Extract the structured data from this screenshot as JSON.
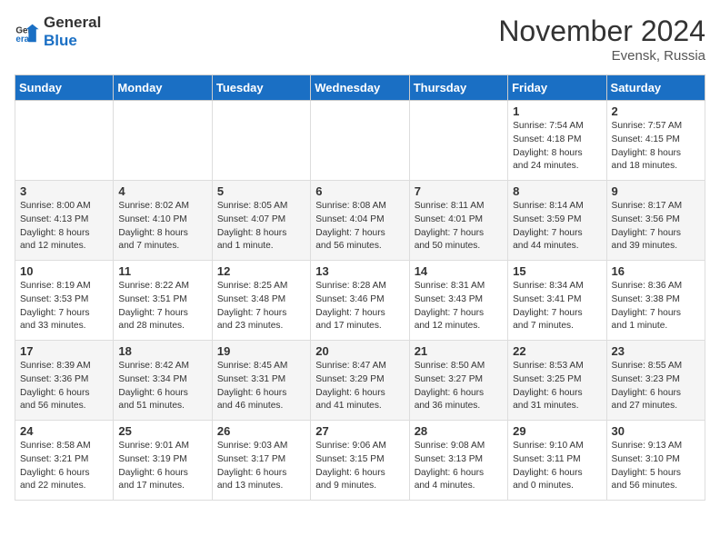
{
  "header": {
    "logo_general": "General",
    "logo_blue": "Blue",
    "month_title": "November 2024",
    "location": "Evensk, Russia"
  },
  "days_of_week": [
    "Sunday",
    "Monday",
    "Tuesday",
    "Wednesday",
    "Thursday",
    "Friday",
    "Saturday"
  ],
  "weeks": [
    [
      {
        "day": "",
        "info": ""
      },
      {
        "day": "",
        "info": ""
      },
      {
        "day": "",
        "info": ""
      },
      {
        "day": "",
        "info": ""
      },
      {
        "day": "",
        "info": ""
      },
      {
        "day": "1",
        "info": "Sunrise: 7:54 AM\nSunset: 4:18 PM\nDaylight: 8 hours\nand 24 minutes."
      },
      {
        "day": "2",
        "info": "Sunrise: 7:57 AM\nSunset: 4:15 PM\nDaylight: 8 hours\nand 18 minutes."
      }
    ],
    [
      {
        "day": "3",
        "info": "Sunrise: 8:00 AM\nSunset: 4:13 PM\nDaylight: 8 hours\nand 12 minutes."
      },
      {
        "day": "4",
        "info": "Sunrise: 8:02 AM\nSunset: 4:10 PM\nDaylight: 8 hours\nand 7 minutes."
      },
      {
        "day": "5",
        "info": "Sunrise: 8:05 AM\nSunset: 4:07 PM\nDaylight: 8 hours\nand 1 minute."
      },
      {
        "day": "6",
        "info": "Sunrise: 8:08 AM\nSunset: 4:04 PM\nDaylight: 7 hours\nand 56 minutes."
      },
      {
        "day": "7",
        "info": "Sunrise: 8:11 AM\nSunset: 4:01 PM\nDaylight: 7 hours\nand 50 minutes."
      },
      {
        "day": "8",
        "info": "Sunrise: 8:14 AM\nSunset: 3:59 PM\nDaylight: 7 hours\nand 44 minutes."
      },
      {
        "day": "9",
        "info": "Sunrise: 8:17 AM\nSunset: 3:56 PM\nDaylight: 7 hours\nand 39 minutes."
      }
    ],
    [
      {
        "day": "10",
        "info": "Sunrise: 8:19 AM\nSunset: 3:53 PM\nDaylight: 7 hours\nand 33 minutes."
      },
      {
        "day": "11",
        "info": "Sunrise: 8:22 AM\nSunset: 3:51 PM\nDaylight: 7 hours\nand 28 minutes."
      },
      {
        "day": "12",
        "info": "Sunrise: 8:25 AM\nSunset: 3:48 PM\nDaylight: 7 hours\nand 23 minutes."
      },
      {
        "day": "13",
        "info": "Sunrise: 8:28 AM\nSunset: 3:46 PM\nDaylight: 7 hours\nand 17 minutes."
      },
      {
        "day": "14",
        "info": "Sunrise: 8:31 AM\nSunset: 3:43 PM\nDaylight: 7 hours\nand 12 minutes."
      },
      {
        "day": "15",
        "info": "Sunrise: 8:34 AM\nSunset: 3:41 PM\nDaylight: 7 hours\nand 7 minutes."
      },
      {
        "day": "16",
        "info": "Sunrise: 8:36 AM\nSunset: 3:38 PM\nDaylight: 7 hours\nand 1 minute."
      }
    ],
    [
      {
        "day": "17",
        "info": "Sunrise: 8:39 AM\nSunset: 3:36 PM\nDaylight: 6 hours\nand 56 minutes."
      },
      {
        "day": "18",
        "info": "Sunrise: 8:42 AM\nSunset: 3:34 PM\nDaylight: 6 hours\nand 51 minutes."
      },
      {
        "day": "19",
        "info": "Sunrise: 8:45 AM\nSunset: 3:31 PM\nDaylight: 6 hours\nand 46 minutes."
      },
      {
        "day": "20",
        "info": "Sunrise: 8:47 AM\nSunset: 3:29 PM\nDaylight: 6 hours\nand 41 minutes."
      },
      {
        "day": "21",
        "info": "Sunrise: 8:50 AM\nSunset: 3:27 PM\nDaylight: 6 hours\nand 36 minutes."
      },
      {
        "day": "22",
        "info": "Sunrise: 8:53 AM\nSunset: 3:25 PM\nDaylight: 6 hours\nand 31 minutes."
      },
      {
        "day": "23",
        "info": "Sunrise: 8:55 AM\nSunset: 3:23 PM\nDaylight: 6 hours\nand 27 minutes."
      }
    ],
    [
      {
        "day": "24",
        "info": "Sunrise: 8:58 AM\nSunset: 3:21 PM\nDaylight: 6 hours\nand 22 minutes."
      },
      {
        "day": "25",
        "info": "Sunrise: 9:01 AM\nSunset: 3:19 PM\nDaylight: 6 hours\nand 17 minutes."
      },
      {
        "day": "26",
        "info": "Sunrise: 9:03 AM\nSunset: 3:17 PM\nDaylight: 6 hours\nand 13 minutes."
      },
      {
        "day": "27",
        "info": "Sunrise: 9:06 AM\nSunset: 3:15 PM\nDaylight: 6 hours\nand 9 minutes."
      },
      {
        "day": "28",
        "info": "Sunrise: 9:08 AM\nSunset: 3:13 PM\nDaylight: 6 hours\nand 4 minutes."
      },
      {
        "day": "29",
        "info": "Sunrise: 9:10 AM\nSunset: 3:11 PM\nDaylight: 6 hours\nand 0 minutes."
      },
      {
        "day": "30",
        "info": "Sunrise: 9:13 AM\nSunset: 3:10 PM\nDaylight: 5 hours\nand 56 minutes."
      }
    ]
  ]
}
